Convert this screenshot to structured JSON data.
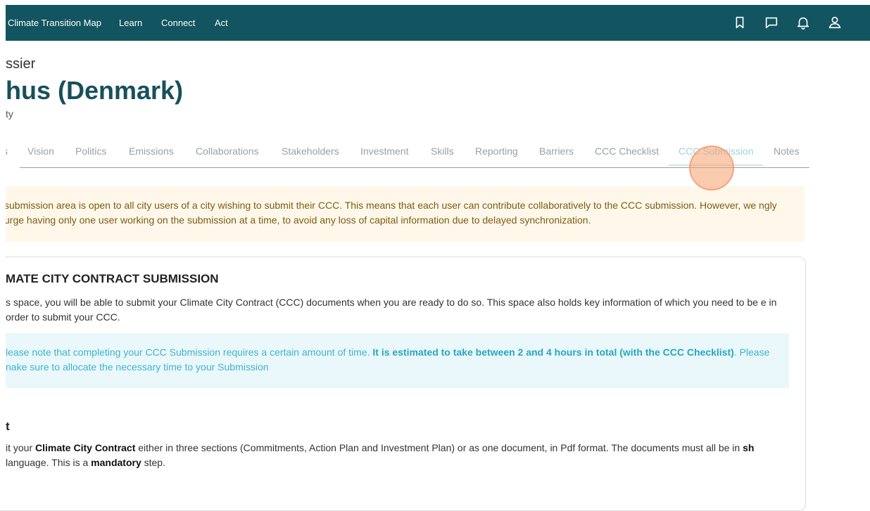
{
  "nav": {
    "items": [
      "Climate Transition Map",
      "Learn",
      "Connect",
      "Act"
    ],
    "icons": [
      "bookmark-icon",
      "chat-icon",
      "bell-icon",
      "user-icon"
    ]
  },
  "header": {
    "breadcrumb": "ssier",
    "title": "hus (Denmark)",
    "subtitle": "ty"
  },
  "tabs": {
    "items": [
      "s",
      "Vision",
      "Politics",
      "Emissions",
      "Collaborations",
      "Stakeholders",
      "Investment",
      "Skills",
      "Reporting",
      "Barriers",
      "CCC Checklist",
      "CCC Submission",
      "Notes"
    ],
    "active": "CCC Submission"
  },
  "warning": {
    "text": "submission area is open to all city users of a city wishing to submit their CCC. This means that each user can contribute collaboratively to the CCC submission. However, we ngly urge having only one user working on the submission at a time, to avoid any loss of capital information due to delayed synchronization."
  },
  "card": {
    "title": "MATE CITY CONTRACT SUBMISSION",
    "intro": "s space, you will be able to submit your Climate City Contract (CCC) documents when you are ready to do so. This space also holds key information of which you need to be e in order to submit your CCC.",
    "note": {
      "part1": "lease note that completing your CCC Submission requires a certain amount of time. ",
      "bold": "It is estimated to take between 2 and 4 hours in total (with the CCC Checklist)",
      "part2": ". Please nake sure to allocate the necessary time to your Submission"
    },
    "section": {
      "title": "t",
      "t1": "it your ",
      "b1": "Climate City Contract",
      "t2": " either in three sections (Commitments, Action Plan and Investment Plan) or as one document, in Pdf format. The documents must all be in ",
      "b2": "sh",
      "t3": " language. This is a ",
      "b3": "mandatory",
      "t4": " step."
    }
  },
  "colors": {
    "topbar": "#125560",
    "title": "#17505b",
    "warning_bg": "#fff8ea",
    "note_bg": "#eaf8fb",
    "note_text": "#3db4cc"
  }
}
